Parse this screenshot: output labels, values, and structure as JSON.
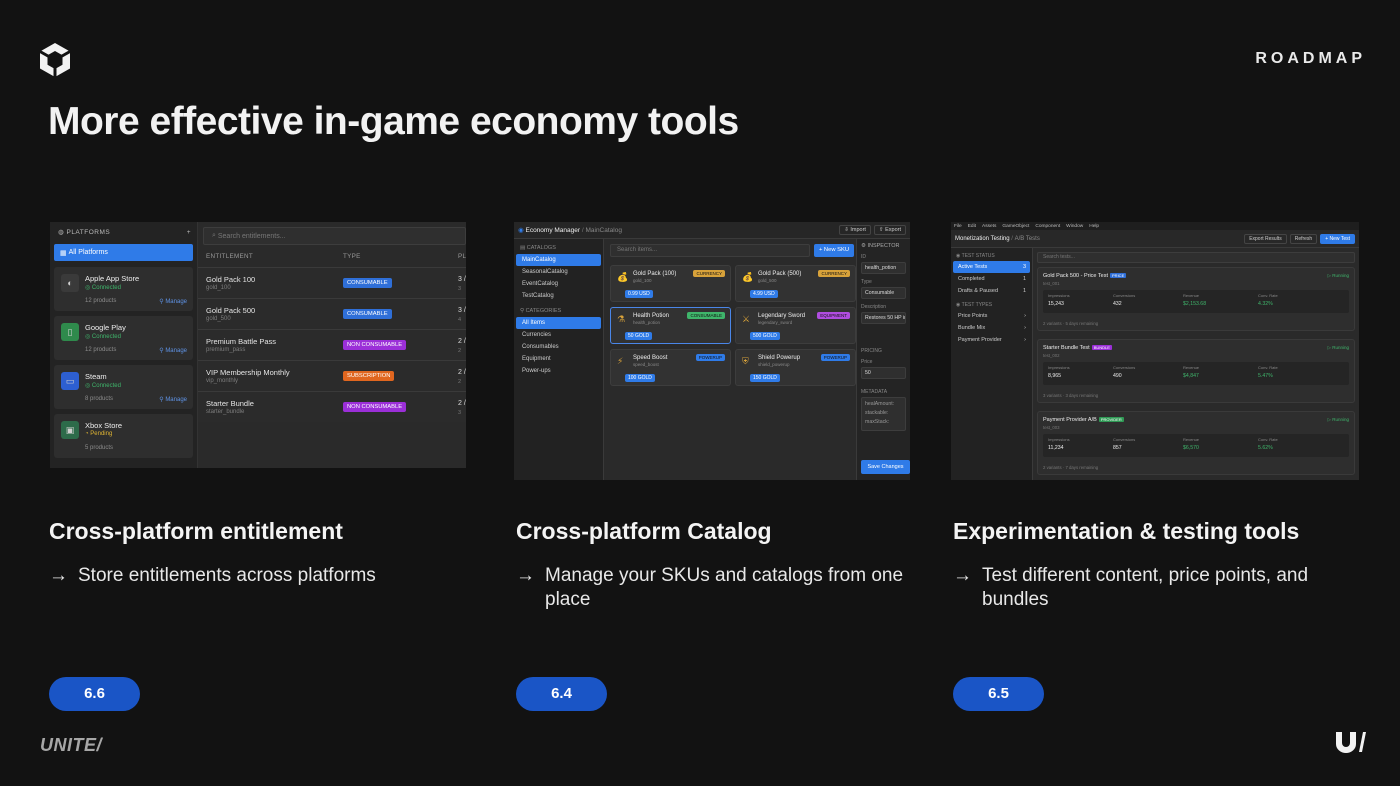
{
  "header": {
    "section_label": "ROADMAP",
    "title": "More effective in-game economy tools"
  },
  "columns": [
    {
      "heading": "Cross-platform entitlement",
      "bullet": "Store entitlements across platforms",
      "version": "6.6"
    },
    {
      "heading": "Cross-platform Catalog",
      "bullet": "Manage your SKUs and catalogs from one place",
      "version": "6.4"
    },
    {
      "heading": "Experimentation & testing tools",
      "bullet": "Test different content, price points, and bundles",
      "version": "6.5"
    }
  ],
  "footer": {
    "event_logo_text": "UNITE/"
  },
  "shot1": {
    "sidebar_title": "PLATFORMS",
    "add": "+",
    "all_platforms": "All Platforms",
    "platforms": [
      {
        "name": "Apple App Store",
        "status": "Connected",
        "count": "12 products",
        "manage": "Manage",
        "icon": "apple-icon",
        "status_color": "#3fb56b"
      },
      {
        "name": "Google Play",
        "status": "Connected",
        "count": "12 products",
        "manage": "Manage",
        "icon": "android-icon",
        "status_color": "#3fb56b"
      },
      {
        "name": "Steam",
        "status": "Connected",
        "count": "8 products",
        "manage": "Manage",
        "icon": "monitor-icon",
        "status_color": "#3fb56b"
      },
      {
        "name": "Xbox Store",
        "status": "Pending",
        "count": "5 products",
        "manage": "",
        "icon": "gamepad-icon",
        "status_color": "#e0b533"
      }
    ],
    "search_placeholder": "Search entitlements...",
    "columns": [
      "ENTITLEMENT",
      "TYPE",
      "PL"
    ],
    "rows": [
      {
        "name": "Gold Pack 100",
        "sku": "gold_100",
        "type": "CONSUMABLE",
        "color": "#2f6fd8",
        "count": "3 /",
        "sub": "3"
      },
      {
        "name": "Gold Pack 500",
        "sku": "gold_500",
        "type": "CONSUMABLE",
        "color": "#2f6fd8",
        "count": "3 /",
        "sub": "4"
      },
      {
        "name": "Premium Battle Pass",
        "sku": "premium_pass",
        "type": "NON CONSUMABLE",
        "color": "#9b2fd8",
        "count": "2 /",
        "sub": "2"
      },
      {
        "name": "VIP Membership Monthly",
        "sku": "vip_monthly",
        "type": "SUBSCRIPTION",
        "color": "#e0661f",
        "count": "2 /",
        "sub": "2"
      },
      {
        "name": "Starter Bundle",
        "sku": "starter_bundle",
        "type": "NON CONSUMABLE",
        "color": "#9b2fd8",
        "count": "2 /",
        "sub": "3"
      }
    ]
  },
  "shot2": {
    "app_title": "Economy Manager",
    "breadcrumb": "MainCatalog",
    "import": "Import",
    "export": "Export",
    "catalogs_header": "CATALOGS",
    "catalogs": [
      "MainCatalog",
      "SeasonalCatalog",
      "EventCatalog",
      "TestCatalog"
    ],
    "categories_header": "CATEGORIES",
    "categories": [
      "All Items",
      "Currencies",
      "Consumables",
      "Equipment",
      "Power-ups"
    ],
    "search_placeholder": "Search items...",
    "new_sku": "+ New SKU",
    "items": [
      {
        "name": "Gold Pack (100)",
        "sku": "gold_100",
        "tag": "CURRENCY",
        "tag_color": "#d8a23a",
        "price": "0.99 USD",
        "icon": "coin-bag-icon"
      },
      {
        "name": "Gold Pack (500)",
        "sku": "gold_500",
        "tag": "CURRENCY",
        "tag_color": "#d8a23a",
        "price": "4.99 USD",
        "icon": "coin-bag-icon"
      },
      {
        "name": "Health Potion",
        "sku": "health_potion",
        "tag": "CONSUMABLE",
        "tag_color": "#3fb56b",
        "price": "50 GOLD",
        "icon": "potion-icon"
      },
      {
        "name": "Legendary Sword",
        "sku": "legendary_sword",
        "tag": "EQUIPMENT",
        "tag_color": "#b04de0",
        "price": "500 GOLD",
        "icon": "sword-icon"
      },
      {
        "name": "Speed Boost",
        "sku": "speed_boost",
        "tag": "POWERUP",
        "tag_color": "#2f7be8",
        "price": "100 GOLD",
        "icon": "lightning-icon"
      },
      {
        "name": "Shield Powerup",
        "sku": "shield_powerup",
        "tag": "POWERUP",
        "tag_color": "#2f7be8",
        "price": "150 GOLD",
        "icon": "shield-icon"
      }
    ],
    "inspector": {
      "title": "INSPECTOR",
      "id_label": "ID",
      "id_value": "health_potion",
      "type_label": "Type",
      "type_value": "Consumable",
      "desc_label": "Description",
      "desc_value": "Restores 50 HP in",
      "pricing_label": "PRICING",
      "price_label": "Price",
      "price_value": "50",
      "metadata_label": "METADATA",
      "metadata_values": [
        "healAmount:",
        "stackable:",
        "maxStack:"
      ],
      "save": "Save Changes"
    }
  },
  "shot3": {
    "menu": [
      "File",
      "Edit",
      "Assets",
      "GameObject",
      "Component",
      "Window",
      "Help"
    ],
    "app_title": "Monetization Testing",
    "breadcrumb": "A/B Tests",
    "export": "Export Results",
    "refresh": "Refresh",
    "new_test": "+ New Test",
    "status_header": "TEST STATUS",
    "statuses": [
      {
        "label": "Active Tests",
        "count": "3"
      },
      {
        "label": "Completed",
        "count": "1"
      },
      {
        "label": "Drafts & Paused",
        "count": "1"
      }
    ],
    "types_header": "TEST TYPES",
    "types": [
      "Price Points",
      "Bundle Mix",
      "Payment Provider"
    ],
    "search_placeholder": "Search tests...",
    "stat_labels": [
      "Impressions",
      "Conversions",
      "Revenue",
      "Conv. Rate"
    ],
    "tests": [
      {
        "name": "Gold Pack 500 - Price Test",
        "id": "test_001",
        "tag": "PRICE",
        "tag_color": "#2f6fd8",
        "status": "Running",
        "impressions": "15,243",
        "conversions": "432",
        "revenue": "$2,153.68",
        "rate": "4.32%",
        "footer": "2 variants · 5 days remaining"
      },
      {
        "name": "Starter Bundle Test",
        "id": "test_002",
        "tag": "BUNDLE",
        "tag_color": "#9b2fd8",
        "status": "Running",
        "impressions": "8,965",
        "conversions": "490",
        "revenue": "$4,847",
        "rate": "5.47%",
        "footer": "3 variants · 3 days remaining"
      },
      {
        "name": "Payment Provider A/B",
        "id": "test_003",
        "tag": "PROVIDER",
        "tag_color": "#2f9a55",
        "status": "Running",
        "impressions": "11,234",
        "conversions": "857",
        "revenue": "$6,570",
        "rate": "5.62%",
        "footer": "2 variants · 7 days remaining"
      }
    ]
  }
}
